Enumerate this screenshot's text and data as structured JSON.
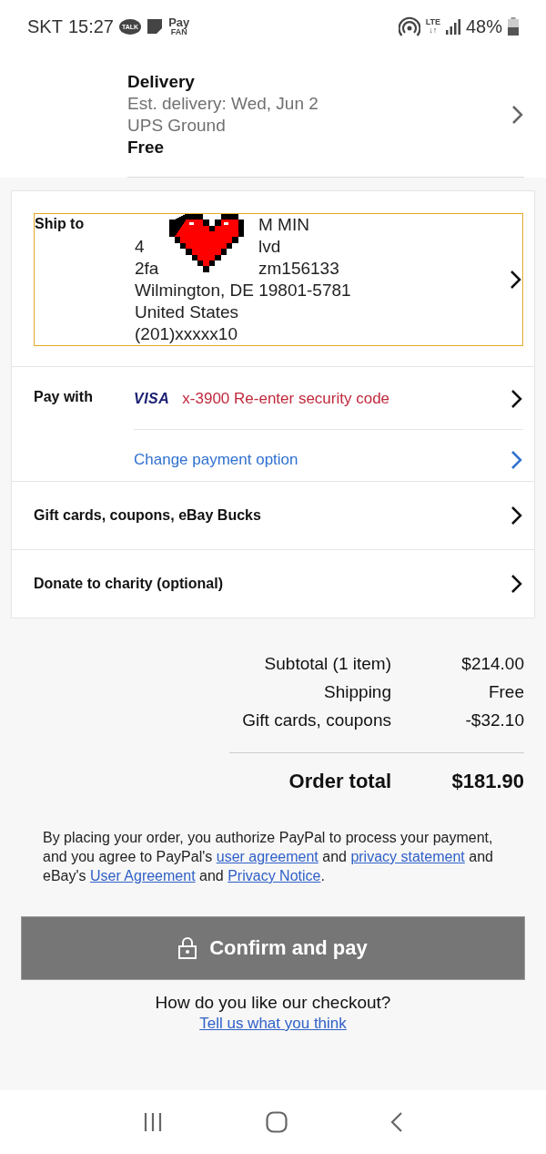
{
  "status_bar": {
    "carrier": "SKT",
    "time": "15:27",
    "notif_pay": "Pay",
    "notif_pay_sub": "FAN",
    "notif_talk": "TALK",
    "network": "LTE",
    "network_arrows": "↓↑",
    "battery": "48%"
  },
  "delivery": {
    "title": "Delivery",
    "estimate": "Est. delivery: Wed, Jun 2",
    "service": "UPS Ground",
    "price": "Free"
  },
  "ship_to": {
    "label": "Ship to",
    "focused": true,
    "lines": [
      {
        "after": "M MIN"
      },
      {
        "before": "4",
        "after": "lvd"
      },
      {
        "before": "2fa",
        "after": "zm156133"
      },
      {
        "before": "Wilmington, DE 19801-5781"
      },
      {
        "before": "United States"
      },
      {
        "before": "(201)xxxxx10"
      }
    ]
  },
  "pay_with": {
    "label": "Pay with",
    "card_brand": "VISA",
    "card_text": "x-3900 Re-enter security code",
    "change_link": "Change payment option"
  },
  "rows": [
    {
      "label": "Gift cards, coupons, eBay Bucks"
    },
    {
      "label": "Donate to charity (optional)"
    }
  ],
  "summary": [
    {
      "label": "Subtotal (1 item)",
      "value": "$214.00"
    },
    {
      "label": "Shipping",
      "value": "Free"
    },
    {
      "label": "Gift cards, coupons",
      "value": "-$32.10"
    }
  ],
  "order_total": {
    "label": "Order total",
    "value": "$181.90"
  },
  "legal": [
    {
      "kind": "text",
      "text": "By placing your order, you authorize PayPal to process your payment, and you agree to PayPal's "
    },
    {
      "kind": "link",
      "text": "user agreement"
    },
    {
      "kind": "text",
      "text": " and "
    },
    {
      "kind": "link",
      "text": "privacy statement"
    },
    {
      "kind": "text",
      "text": " and eBay's "
    },
    {
      "kind": "link",
      "text": "User Agreement"
    },
    {
      "kind": "text",
      "text": " and "
    },
    {
      "kind": "link",
      "text": "Privacy Notice"
    },
    {
      "kind": "text",
      "text": "."
    }
  ],
  "confirm_button": {
    "label": "Confirm and pay",
    "disabled": true
  },
  "feedback": {
    "question": "How do you like our checkout?",
    "link": "Tell us what you think"
  }
}
